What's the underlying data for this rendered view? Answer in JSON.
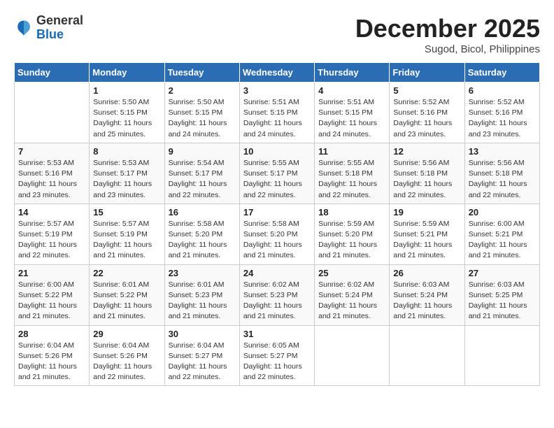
{
  "header": {
    "logo_general": "General",
    "logo_blue": "Blue",
    "month": "December 2025",
    "location": "Sugod, Bicol, Philippines"
  },
  "weekdays": [
    "Sunday",
    "Monday",
    "Tuesday",
    "Wednesday",
    "Thursday",
    "Friday",
    "Saturday"
  ],
  "weeks": [
    [
      {
        "day": "",
        "info": ""
      },
      {
        "day": "1",
        "info": "Sunrise: 5:50 AM\nSunset: 5:15 PM\nDaylight: 11 hours\nand 25 minutes."
      },
      {
        "day": "2",
        "info": "Sunrise: 5:50 AM\nSunset: 5:15 PM\nDaylight: 11 hours\nand 24 minutes."
      },
      {
        "day": "3",
        "info": "Sunrise: 5:51 AM\nSunset: 5:15 PM\nDaylight: 11 hours\nand 24 minutes."
      },
      {
        "day": "4",
        "info": "Sunrise: 5:51 AM\nSunset: 5:15 PM\nDaylight: 11 hours\nand 24 minutes."
      },
      {
        "day": "5",
        "info": "Sunrise: 5:52 AM\nSunset: 5:16 PM\nDaylight: 11 hours\nand 23 minutes."
      },
      {
        "day": "6",
        "info": "Sunrise: 5:52 AM\nSunset: 5:16 PM\nDaylight: 11 hours\nand 23 minutes."
      }
    ],
    [
      {
        "day": "7",
        "info": "Sunrise: 5:53 AM\nSunset: 5:16 PM\nDaylight: 11 hours\nand 23 minutes."
      },
      {
        "day": "8",
        "info": "Sunrise: 5:53 AM\nSunset: 5:17 PM\nDaylight: 11 hours\nand 23 minutes."
      },
      {
        "day": "9",
        "info": "Sunrise: 5:54 AM\nSunset: 5:17 PM\nDaylight: 11 hours\nand 22 minutes."
      },
      {
        "day": "10",
        "info": "Sunrise: 5:55 AM\nSunset: 5:17 PM\nDaylight: 11 hours\nand 22 minutes."
      },
      {
        "day": "11",
        "info": "Sunrise: 5:55 AM\nSunset: 5:18 PM\nDaylight: 11 hours\nand 22 minutes."
      },
      {
        "day": "12",
        "info": "Sunrise: 5:56 AM\nSunset: 5:18 PM\nDaylight: 11 hours\nand 22 minutes."
      },
      {
        "day": "13",
        "info": "Sunrise: 5:56 AM\nSunset: 5:18 PM\nDaylight: 11 hours\nand 22 minutes."
      }
    ],
    [
      {
        "day": "14",
        "info": "Sunrise: 5:57 AM\nSunset: 5:19 PM\nDaylight: 11 hours\nand 22 minutes."
      },
      {
        "day": "15",
        "info": "Sunrise: 5:57 AM\nSunset: 5:19 PM\nDaylight: 11 hours\nand 21 minutes."
      },
      {
        "day": "16",
        "info": "Sunrise: 5:58 AM\nSunset: 5:20 PM\nDaylight: 11 hours\nand 21 minutes."
      },
      {
        "day": "17",
        "info": "Sunrise: 5:58 AM\nSunset: 5:20 PM\nDaylight: 11 hours\nand 21 minutes."
      },
      {
        "day": "18",
        "info": "Sunrise: 5:59 AM\nSunset: 5:20 PM\nDaylight: 11 hours\nand 21 minutes."
      },
      {
        "day": "19",
        "info": "Sunrise: 5:59 AM\nSunset: 5:21 PM\nDaylight: 11 hours\nand 21 minutes."
      },
      {
        "day": "20",
        "info": "Sunrise: 6:00 AM\nSunset: 5:21 PM\nDaylight: 11 hours\nand 21 minutes."
      }
    ],
    [
      {
        "day": "21",
        "info": "Sunrise: 6:00 AM\nSunset: 5:22 PM\nDaylight: 11 hours\nand 21 minutes."
      },
      {
        "day": "22",
        "info": "Sunrise: 6:01 AM\nSunset: 5:22 PM\nDaylight: 11 hours\nand 21 minutes."
      },
      {
        "day": "23",
        "info": "Sunrise: 6:01 AM\nSunset: 5:23 PM\nDaylight: 11 hours\nand 21 minutes."
      },
      {
        "day": "24",
        "info": "Sunrise: 6:02 AM\nSunset: 5:23 PM\nDaylight: 11 hours\nand 21 minutes."
      },
      {
        "day": "25",
        "info": "Sunrise: 6:02 AM\nSunset: 5:24 PM\nDaylight: 11 hours\nand 21 minutes."
      },
      {
        "day": "26",
        "info": "Sunrise: 6:03 AM\nSunset: 5:24 PM\nDaylight: 11 hours\nand 21 minutes."
      },
      {
        "day": "27",
        "info": "Sunrise: 6:03 AM\nSunset: 5:25 PM\nDaylight: 11 hours\nand 21 minutes."
      }
    ],
    [
      {
        "day": "28",
        "info": "Sunrise: 6:04 AM\nSunset: 5:26 PM\nDaylight: 11 hours\nand 21 minutes."
      },
      {
        "day": "29",
        "info": "Sunrise: 6:04 AM\nSunset: 5:26 PM\nDaylight: 11 hours\nand 22 minutes."
      },
      {
        "day": "30",
        "info": "Sunrise: 6:04 AM\nSunset: 5:27 PM\nDaylight: 11 hours\nand 22 minutes."
      },
      {
        "day": "31",
        "info": "Sunrise: 6:05 AM\nSunset: 5:27 PM\nDaylight: 11 hours\nand 22 minutes."
      },
      {
        "day": "",
        "info": ""
      },
      {
        "day": "",
        "info": ""
      },
      {
        "day": "",
        "info": ""
      }
    ]
  ]
}
